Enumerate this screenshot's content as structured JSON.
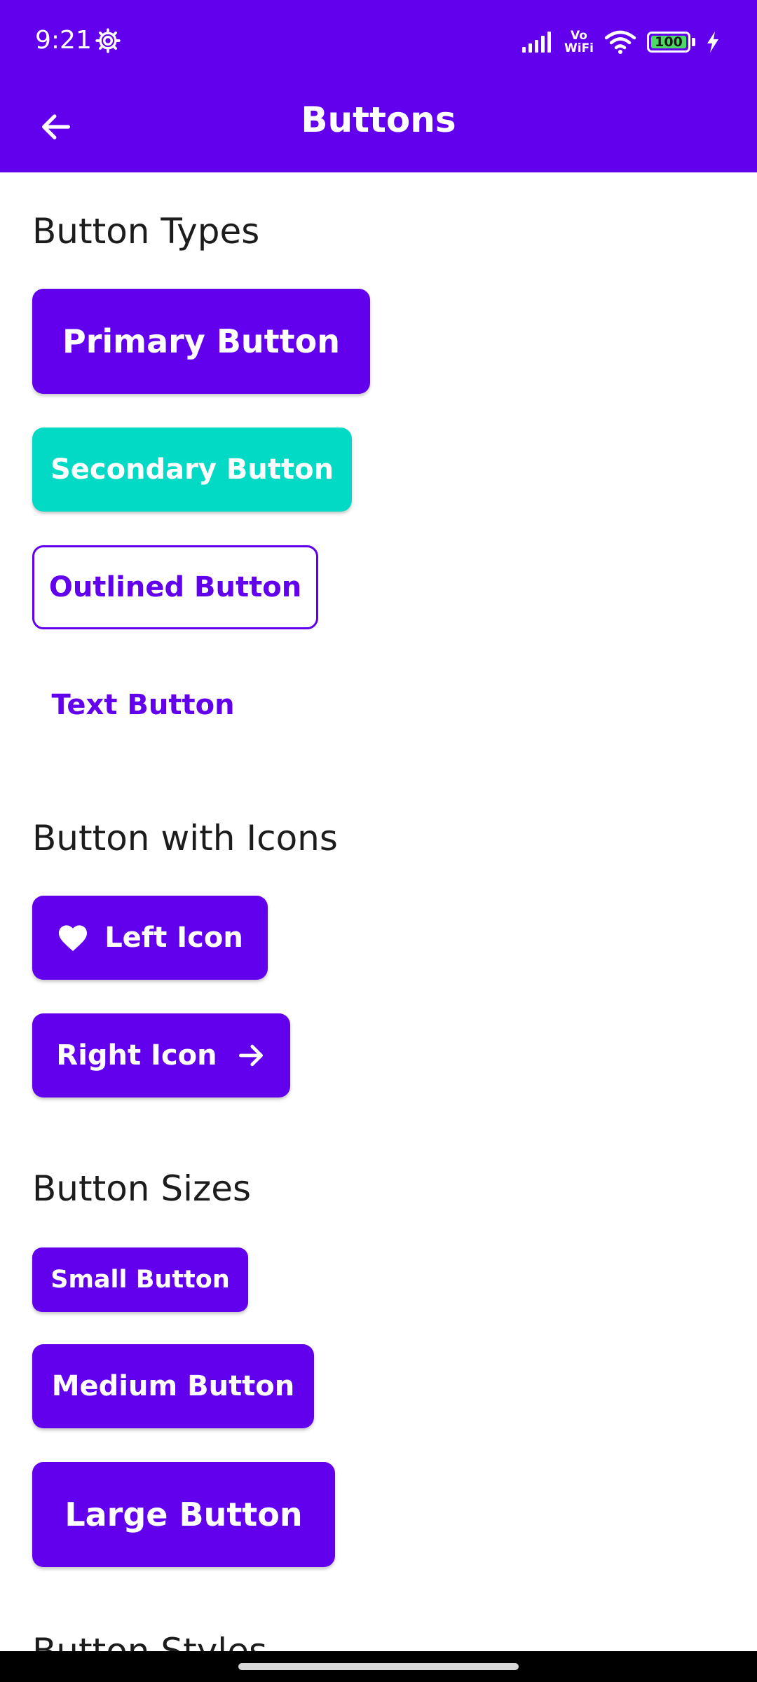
{
  "status_bar": {
    "time": "9:21",
    "network_label_top": "Vo",
    "network_label_bottom": "WiFi",
    "battery_level": "100",
    "icons": [
      "gear-icon",
      "signal-icon",
      "wifi-icon",
      "battery-icon",
      "charging-icon"
    ]
  },
  "app_bar": {
    "title": "Buttons",
    "back_icon": "arrow-left-icon"
  },
  "sections": {
    "types": {
      "title": "Button Types",
      "primary": "Primary Button",
      "secondary": "Secondary Button",
      "outlined": "Outlined Button",
      "text": "Text Button"
    },
    "icons": {
      "title": "Button with Icons",
      "left_icon": "Left Icon",
      "right_icon": "Right Icon"
    },
    "sizes": {
      "title": "Button Sizes",
      "small": "Small Button",
      "medium": "Medium Button",
      "large": "Large Button"
    },
    "next": {
      "title": "Button Styles"
    }
  },
  "colors": {
    "primary": "#6200ee",
    "secondary": "#03dac5",
    "on_primary": "#ffffff",
    "text_dark": "#1c1c1c"
  }
}
